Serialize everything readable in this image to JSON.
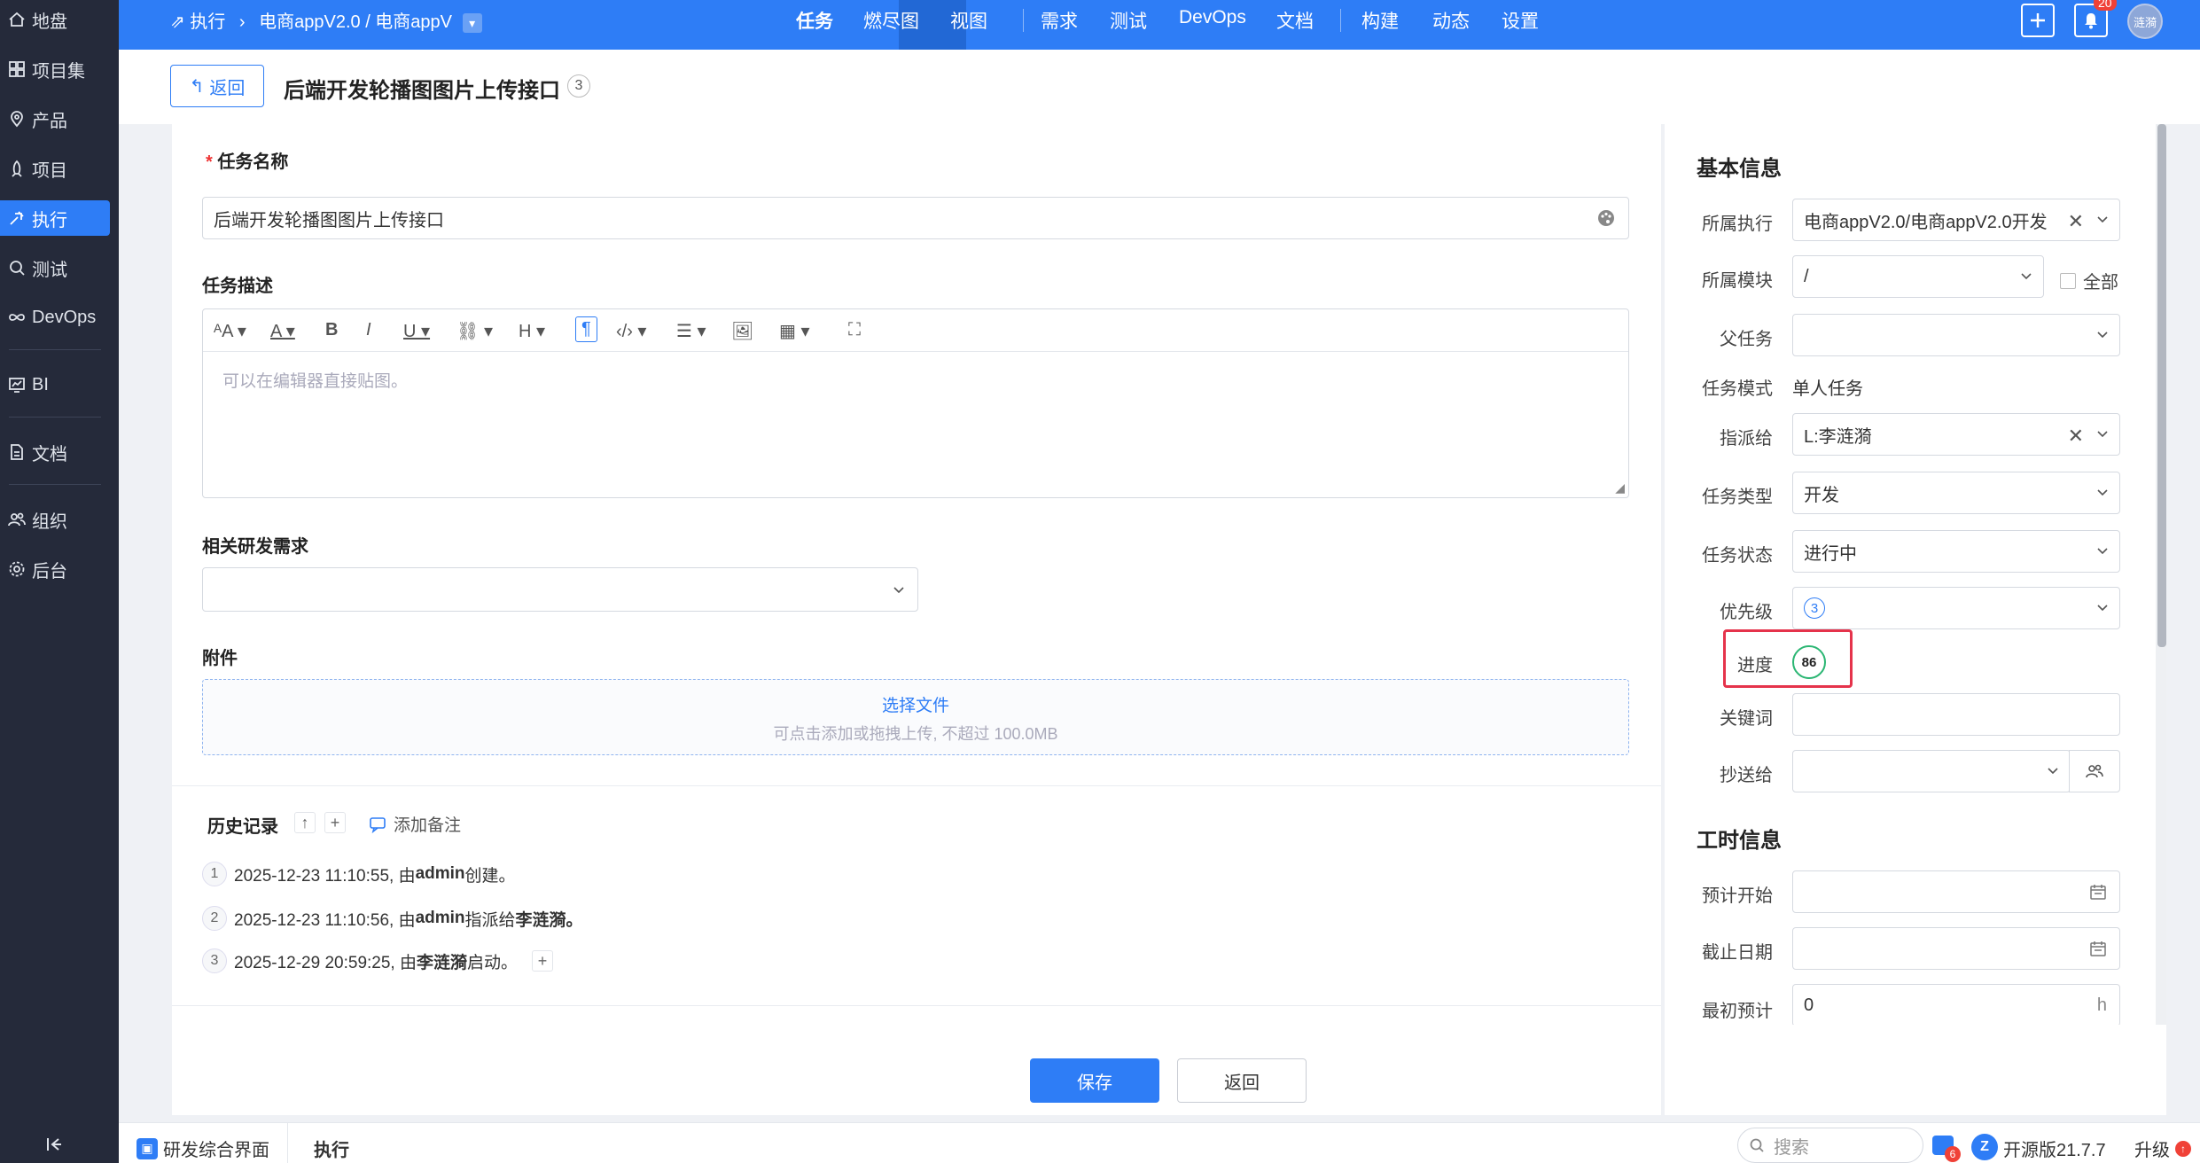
{
  "sidebar": {
    "items": [
      {
        "label": "地盘",
        "icon": "home-icon"
      },
      {
        "label": "项目集",
        "icon": "grid-icon"
      },
      {
        "label": "产品",
        "icon": "location-icon"
      },
      {
        "label": "项目",
        "icon": "rocket-icon"
      },
      {
        "label": "执行",
        "icon": "run-icon"
      },
      {
        "label": "测试",
        "icon": "search-icon"
      },
      {
        "label": "DevOps",
        "icon": "infinity-icon"
      },
      {
        "label": "BI",
        "icon": "chart-icon"
      },
      {
        "label": "文档",
        "icon": "document-icon"
      },
      {
        "label": "组织",
        "icon": "people-icon"
      },
      {
        "label": "后台",
        "icon": "gear-icon"
      }
    ]
  },
  "topbar": {
    "breadcrumb_root": "执行",
    "breadcrumb_path": "电商appV2.0 / 电商appV",
    "nav": [
      "任务",
      "燃尽图",
      "视图",
      "需求",
      "测试",
      "DevOps",
      "文档",
      "构建",
      "动态",
      "设置"
    ],
    "notif_count": "20",
    "avatar": "涟漪"
  },
  "header": {
    "back": "返回",
    "title": "后端开发轮播图图片上传接口",
    "count": "3"
  },
  "form": {
    "name_label": "任务名称",
    "name_value": "后端开发轮播图图片上传接口",
    "desc_label": "任务描述",
    "desc_placeholder": "可以在编辑器直接贴图。",
    "story_label": "相关研发需求",
    "attach_label": "附件",
    "attach_link": "选择文件",
    "attach_hint": "可点击添加或拖拽上传, 不超过 100.0MB"
  },
  "history": {
    "title": "历史记录",
    "add_note": "添加备注",
    "entries": [
      {
        "n": "1",
        "time": "2025-12-23 11:10:55, 由 ",
        "user": "admin",
        "action": " 创建。",
        "target": ""
      },
      {
        "n": "2",
        "time": "2025-12-23 11:10:56, 由 ",
        "user": "admin",
        "action": " 指派给 ",
        "target": "李涟漪。"
      },
      {
        "n": "3",
        "time": "2025-12-29 20:59:25, 由 ",
        "user": "李涟漪",
        "action": " 启动。",
        "target": ""
      }
    ]
  },
  "actions": {
    "save": "保存",
    "back": "返回"
  },
  "basic": {
    "title": "基本信息",
    "execution_label": "所属执行",
    "execution_value": "电商appV2.0/电商appV2.0开发",
    "module_label": "所属模块",
    "module_value": "/",
    "all_label": "全部",
    "parent_label": "父任务",
    "parent_value": "",
    "mode_label": "任务模式",
    "mode_value": "单人任务",
    "assign_label": "指派给",
    "assign_value": "L:李涟漪",
    "type_label": "任务类型",
    "type_value": "开发",
    "status_label": "任务状态",
    "status_value": "进行中",
    "priority_label": "优先级",
    "priority_value": "3",
    "progress_label": "进度",
    "progress_value": "86",
    "keyword_label": "关键词",
    "cc_label": "抄送给"
  },
  "time": {
    "title": "工时信息",
    "est_start_label": "预计开始",
    "deadline_label": "截止日期",
    "estimate_label": "最初预计",
    "estimate_value": "0",
    "estimate_unit": "h"
  },
  "statusbar": {
    "app": "研发综合界面",
    "module": "执行",
    "search": "搜索",
    "msg_count": "6",
    "version": "开源版21.7.7",
    "upgrade": "升级"
  }
}
